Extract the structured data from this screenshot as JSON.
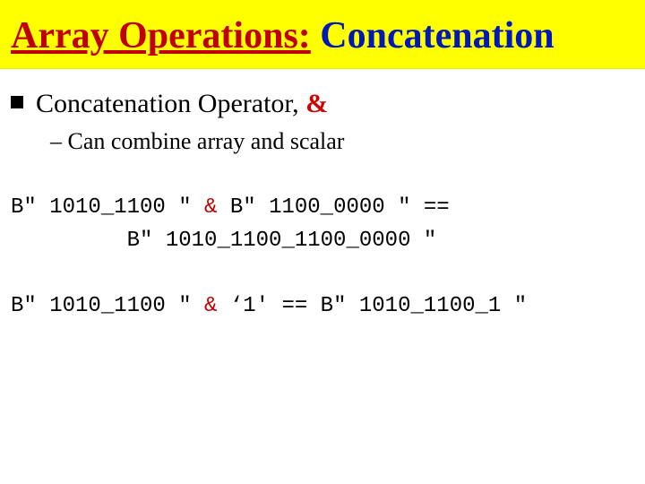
{
  "title": {
    "prefix": "Array Operations:",
    "suffix": " Concatenation"
  },
  "bullet": {
    "text_before_amp": "Concatenation Operator, ",
    "amp": "&"
  },
  "subbullet": {
    "dash": "– ",
    "text": "Can combine array and scalar"
  },
  "code1": {
    "l1a": "B\" 1010_1100 \" ",
    "l1amp": "&",
    "l1b": " B\" 1100_0000 \" ==",
    "l2": "         B\" 1010_1100_1100_0000 \""
  },
  "code2": {
    "a": "B\" 1010_1100 \" ",
    "amp": "&",
    "b": " ‘1' == B\" 1010_1100_1 \""
  }
}
